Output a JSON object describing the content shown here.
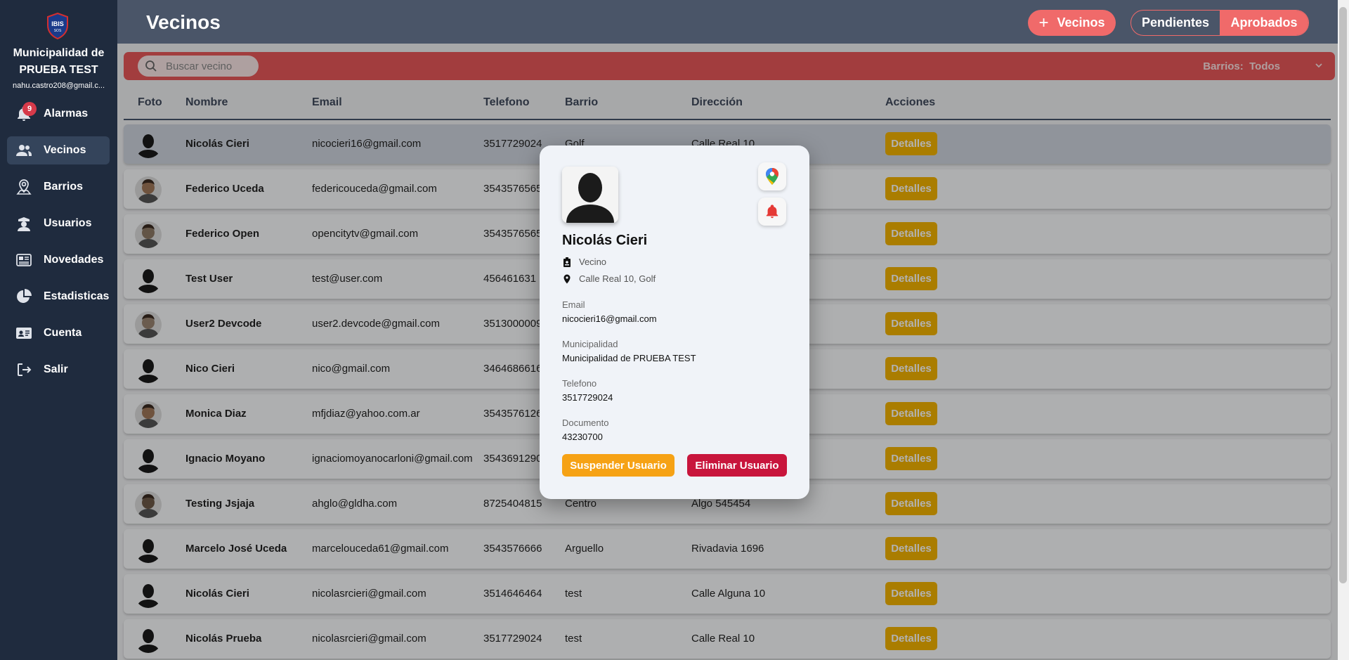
{
  "sidebar": {
    "logo_text": "IBIS",
    "logo_subtext": "SOS",
    "org_name": "Municipalidad de PRUEBA TEST",
    "email": "nahu.castro208@gmail.c...",
    "items": [
      {
        "label": "Alarmas",
        "icon": "bell-icon",
        "badge": "9"
      },
      {
        "label": "Vecinos",
        "icon": "users-icon",
        "active": true
      },
      {
        "label": "Barrios",
        "icon": "map-pin-icon"
      },
      {
        "label": "Usuarios",
        "icon": "police-icon"
      },
      {
        "label": "Novedades",
        "icon": "newspaper-icon"
      },
      {
        "label": "Estadisticas",
        "icon": "pie-chart-icon"
      },
      {
        "label": "Cuenta",
        "icon": "id-card-icon"
      },
      {
        "label": "Salir",
        "icon": "logout-icon"
      }
    ]
  },
  "header": {
    "title": "Vecinos",
    "add_label": "Vecinos",
    "seg_pending": "Pendientes",
    "seg_approved": "Aprobados"
  },
  "search": {
    "placeholder": "Buscar vecino",
    "filter_label": "Barrios:",
    "filter_value": "Todos"
  },
  "table": {
    "columns": [
      "Foto",
      "Nombre",
      "Email",
      "Telefono",
      "Barrio",
      "Dirección",
      "Acciones"
    ],
    "action_label": "Detalles",
    "rows": [
      {
        "name": "Nicolás Cieri",
        "email": "nicocieri16@gmail.com",
        "phone": "3517729024",
        "barrio": "Golf",
        "direccion": "Calle Real 10",
        "avatar": "silhouette"
      },
      {
        "name": "Federico Uceda",
        "email": "federicouceda@gmail.com",
        "phone": "3543576565",
        "barrio": "",
        "direccion": "",
        "avatar": "photo"
      },
      {
        "name": "Federico Open",
        "email": "opencitytv@gmail.com",
        "phone": "3543576565",
        "barrio": "",
        "direccion": "",
        "avatar": "photo"
      },
      {
        "name": "Test User",
        "email": "test@user.com",
        "phone": "456461631",
        "barrio": "",
        "direccion": "",
        "avatar": "silhouette"
      },
      {
        "name": "User2 Devcode",
        "email": "user2.devcode@gmail.com",
        "phone": "3513000009",
        "barrio": "",
        "direccion": "",
        "avatar": "photo"
      },
      {
        "name": "Nico Cieri",
        "email": "nico@gmail.com",
        "phone": "3464686616",
        "barrio": "",
        "direccion": "",
        "avatar": "silhouette"
      },
      {
        "name": "Monica Diaz",
        "email": "mfjdiaz@yahoo.com.ar",
        "phone": "3543576126",
        "barrio": "",
        "direccion": "",
        "avatar": "photo"
      },
      {
        "name": "Ignacio Moyano",
        "email": "ignaciomoyanocarloni@gmail.com",
        "phone": "3543691290",
        "barrio": "",
        "direccion": "",
        "avatar": "silhouette"
      },
      {
        "name": "Testing Jsjaja",
        "email": "ahglo@gldha.com",
        "phone": "8725404815",
        "barrio": "Centro",
        "direccion": "Algo 545454",
        "avatar": "photo"
      },
      {
        "name": "Marcelo José Uceda",
        "email": "marcelouceda61@gmail.com",
        "phone": "3543576666",
        "barrio": "Arguello",
        "direccion": "Rivadavia 1696",
        "avatar": "silhouette"
      },
      {
        "name": "Nicolás Cieri",
        "email": "nicolasrcieri@gmail.com",
        "phone": "3514646464",
        "barrio": "test",
        "direccion": "Calle Alguna 10",
        "avatar": "silhouette"
      },
      {
        "name": "Nicolás Prueba",
        "email": "nicolasrcieri@gmail.com",
        "phone": "3517729024",
        "barrio": "test",
        "direccion": "Calle Real 10",
        "avatar": "silhouette"
      }
    ]
  },
  "modal": {
    "name": "Nicolás Cieri",
    "role": "Vecino",
    "address": "Calle Real 10, Golf",
    "email_label": "Email",
    "email_value": "nicocieri16@gmail.com",
    "muni_label": "Municipalidad",
    "muni_value": "Municipalidad de PRUEBA TEST",
    "phone_label": "Telefono",
    "phone_value": "3517729024",
    "doc_label": "Documento",
    "doc_value": "43230700",
    "suspend_label": "Suspender Usuario",
    "delete_label": "Eliminar Usuario"
  },
  "colors": {
    "sidebar": "#1f2b3e",
    "accent": "#f06a6a",
    "details": "#f4b400",
    "suspend": "#f6a215",
    "delete": "#c8153c"
  }
}
